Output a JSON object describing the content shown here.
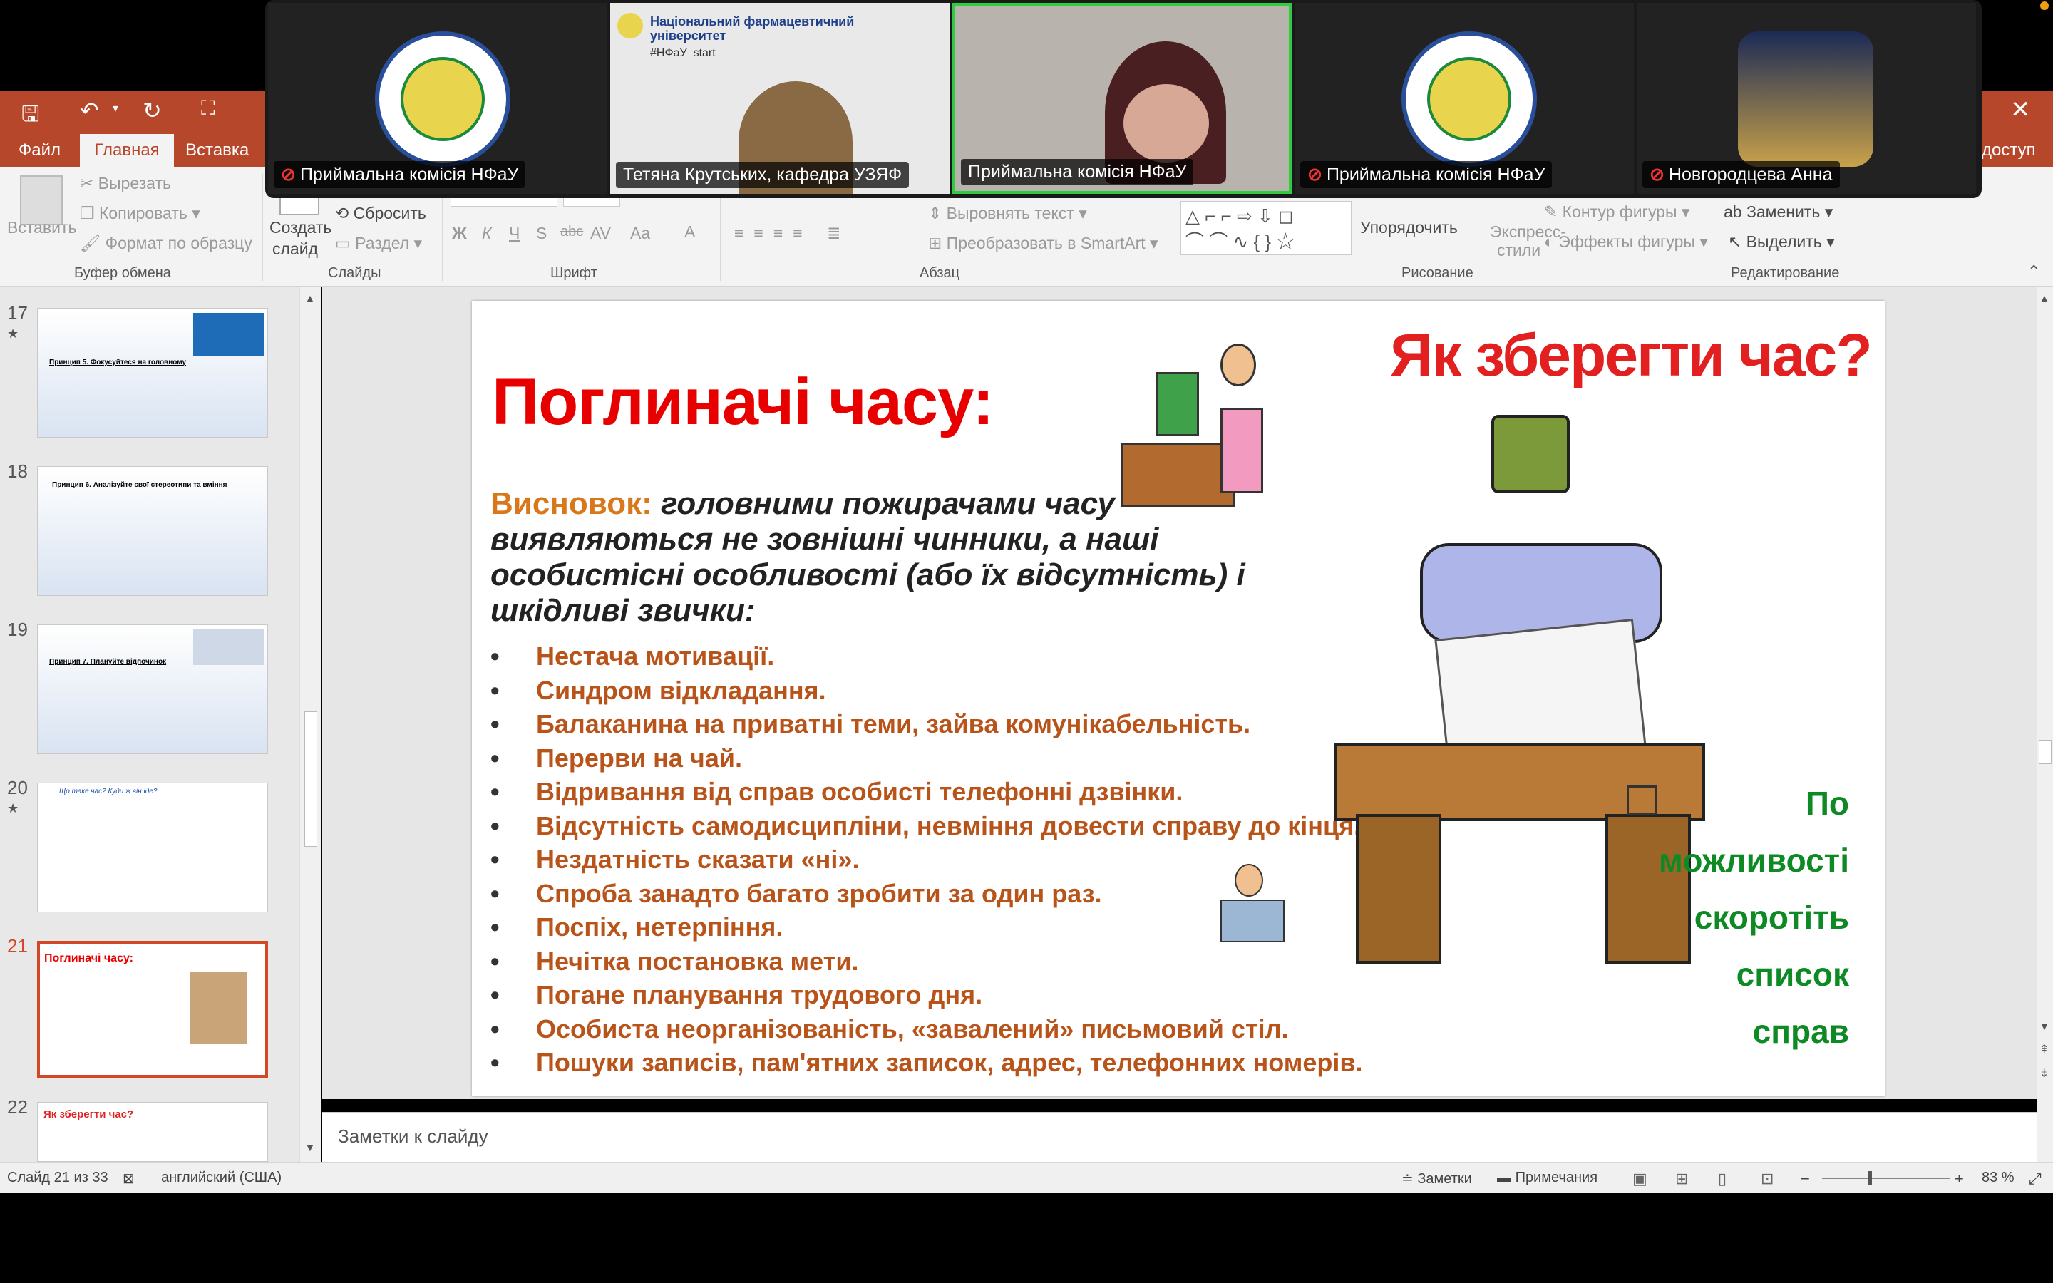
{
  "ribbon": {
    "tabs": [
      "Файл",
      "Главная",
      "Вставка"
    ],
    "active_tab": "Главная",
    "clipboard": {
      "paste": "Вставить",
      "cut": "Вырезать",
      "copy": "Копировать",
      "format_painter": "Формат по образцу",
      "group": "Буфер обмена"
    },
    "slides": {
      "new_slide_1": "Создать",
      "new_slide_2": "слайд",
      "reset": "Сбросить",
      "section": "Раздел",
      "group": "Слайды"
    },
    "font": {
      "group": "Шрифт",
      "bold": "Ж",
      "italic": "К",
      "underline": "Ч",
      "shadow": "S",
      "strike": "abc",
      "spacing": "AV",
      "case": "Aa",
      "color": "A"
    },
    "paragraph": {
      "group": "Абзац",
      "align_text": "Выровнять текст",
      "smartart": "Преобразовать в SmartArt"
    },
    "drawing": {
      "group": "Рисование",
      "arrange": "Упорядочить",
      "quick_styles_1": "Экспресс-",
      "quick_styles_2": "стили",
      "outline": "Контур фигуры",
      "effects": "Эффекты фигуры"
    },
    "editing": {
      "group": "Редактирование",
      "replace": "Заменить",
      "select": "Выделить"
    },
    "share": "доступ"
  },
  "thumbnails": [
    {
      "num": "17",
      "star": "★",
      "text": "Принцип 5. Фокусуйтеся на головному"
    },
    {
      "num": "18",
      "star": "",
      "text": "Принцип 6. Аналізуйте свої стереотипи та вміння"
    },
    {
      "num": "19",
      "star": "",
      "text": "Принцип 7. Плануйте відпочинок"
    },
    {
      "num": "20",
      "star": "★",
      "text": "Що таке час? Куди ж він іде?"
    },
    {
      "num": "21",
      "star": "",
      "text": "Поглиначі часу:"
    },
    {
      "num": "22",
      "star": "",
      "text": "Як зберегти час?"
    }
  ],
  "slide": {
    "title": "Поглиначі часу:",
    "right_title": "Як зберегти  час?",
    "conclusion_label": "Висновок:",
    "conclusion_text": " головними пожирачами часу виявляються не зовнішні чинники, а наші особистісні особливості (або їх відсутність) і шкідливі звички:",
    "bullets": [
      "Нестача мотивації.",
      "Синдром відкладання.",
      "Балаканина на приватні теми, зайва комунікабельність.",
      "Перерви на чай.",
      "Відривання від справ особисті телефонні дзвінки.",
      "Відсутність самодисципліни, невміння довести справу до кінця.",
      "Нездатність сказати «ні».",
      "Спроба занадто багато зробити за один раз.",
      "Поспіх, нетерпіння.",
      "Нечітка постановка мети.",
      "Погане планування трудового дня.",
      "Особиста неорганізованість, «завалений» письмовий стіл.",
      "Пошуки записів, пам'ятних записок, адрес, телефонних номерів."
    ],
    "tip_lines": [
      "По",
      "можливості",
      "скоротіть",
      "список",
      "справ"
    ]
  },
  "notes_placeholder": "Заметки к слайду",
  "status": {
    "slide_info": "Слайд 21 из 33",
    "language": "английский (США)",
    "notes": "Заметки",
    "comments": "Примечания",
    "zoom": "83 %"
  },
  "video": {
    "participants": [
      {
        "name": "Приймальна комісія НФаУ",
        "muted": true
      },
      {
        "name": "Тетяна Крутських, кафедра УЗЯФ",
        "muted": false,
        "banner_1": "Національний фармацевтичний",
        "banner_2": "університет",
        "hashtag": "#НФаУ_start"
      },
      {
        "name": "Приймальна комісія НФаУ",
        "muted": false,
        "active": true
      },
      {
        "name": "Приймальна комісія НФаУ",
        "muted": true
      },
      {
        "name": "Новгородцева Анна",
        "muted": true
      }
    ]
  },
  "colors": {
    "accent": "#b7472a",
    "title_red": "#e80000",
    "bullet_orange": "#b8541a",
    "tip_green": "#0e8a25",
    "active_speaker": "#2ecc40"
  }
}
